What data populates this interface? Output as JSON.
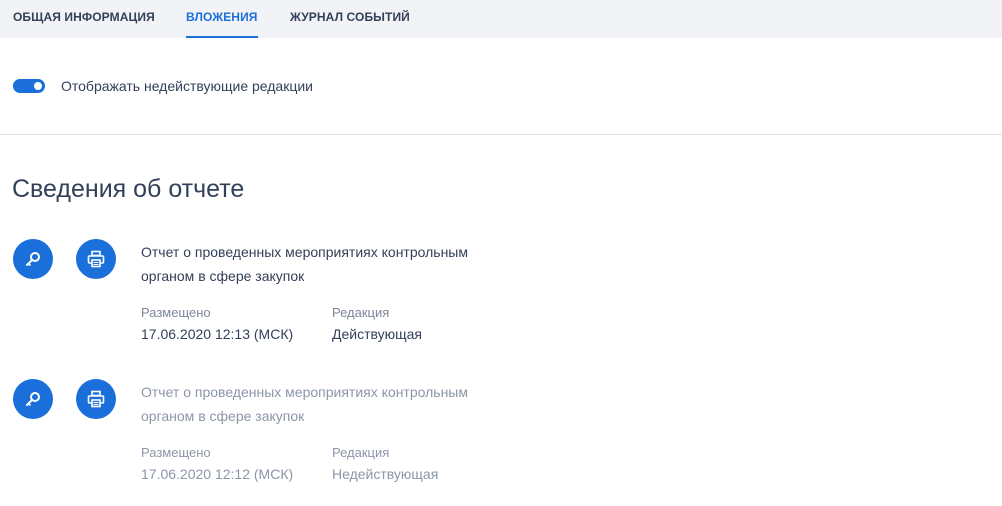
{
  "tabs": [
    {
      "label": "ОБЩАЯ ИНФОРМАЦИЯ",
      "active": false
    },
    {
      "label": "ВЛОЖЕНИЯ",
      "active": true
    },
    {
      "label": "ЖУРНАЛ СОБЫТИЙ",
      "active": false
    }
  ],
  "toggle": {
    "label": "Отображать недействующие редакции",
    "on": true
  },
  "section": {
    "title": "Сведения об отчете"
  },
  "entries": [
    {
      "title": "Отчет о проведенных мероприятиях контрольным органом в сфере закупок",
      "placed_label": "Размещено",
      "placed_value": "17.06.2020 12:13 (МСК)",
      "edition_label": "Редакция",
      "edition_value": "Действующая"
    },
    {
      "title": "Отчет о проведенных мероприятиях контрольным органом в сфере закупок",
      "placed_label": "Размещено",
      "placed_value": "17.06.2020 12:12 (МСК)",
      "edition_label": "Редакция",
      "edition_value": "Недействующая"
    }
  ],
  "colors": {
    "accent": "#1a6fdb",
    "text": "#334059",
    "muted": "#7d8799",
    "inactive": "#8c96a8"
  },
  "icons": {
    "view": "search-key-icon",
    "print": "printer-icon"
  }
}
